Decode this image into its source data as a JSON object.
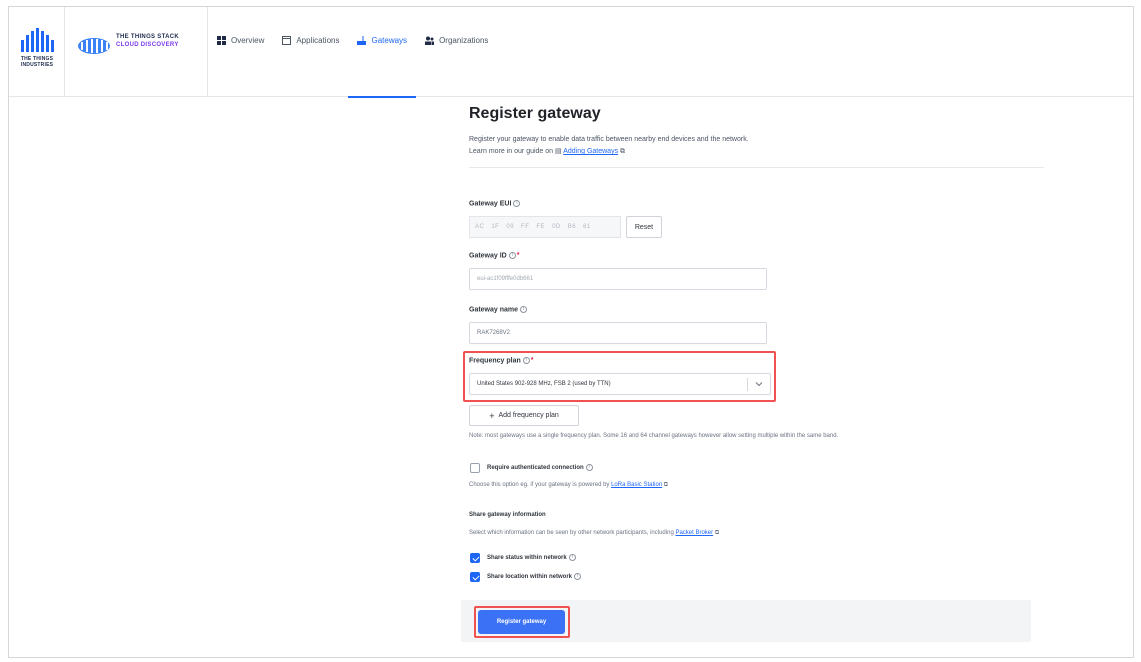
{
  "brand": {
    "ttn_name": "THE THINGS INDUSTRIES",
    "product_line1": "THE THINGS STACK",
    "product_line2": "CLOUD DISCOVERY"
  },
  "nav": {
    "items": [
      {
        "label": "Overview",
        "icon": "grid-icon",
        "active": false
      },
      {
        "label": "Applications",
        "icon": "window-icon",
        "active": false
      },
      {
        "label": "Gateways",
        "icon": "gateway-icon",
        "active": true
      },
      {
        "label": "Organizations",
        "icon": "users-icon",
        "active": false
      }
    ]
  },
  "form": {
    "title": "Register gateway",
    "description": "Register your gateway to enable data traffic between nearby end devices and the network.",
    "guide_prefix": "Learn more in our guide on",
    "guide_link": "Adding Gateways",
    "eui": {
      "label": "Gateway EUI",
      "bytes": [
        "AC",
        "1F",
        "09",
        "FF",
        "FE",
        "0D",
        "B6",
        "61"
      ],
      "reset_label": "Reset"
    },
    "gateway_id": {
      "label": "Gateway ID",
      "placeholder": "eui-ac1f09fffe0db661"
    },
    "gateway_name": {
      "label": "Gateway name",
      "value": "RAK7268V2"
    },
    "frequency_plan": {
      "label": "Frequency plan",
      "selected": "United States 902-928 MHz, FSB 2 (used by TTN)",
      "add_label": "Add frequency plan",
      "note": "Note: most gateways use a single frequency plan. Some 16 and 64 channel gateways however allow setting multiple within the same band."
    },
    "auth": {
      "label": "Require authenticated connection",
      "checked": false,
      "help_prefix": "Choose this option eg. if your gateway is powered by",
      "help_link": "LoRa Basic Station"
    },
    "share": {
      "heading": "Share gateway information",
      "help_prefix": "Select which information can be seen by other network participants, including",
      "help_link": "Packet Broker",
      "status_label": "Share status within network",
      "status_checked": true,
      "location_label": "Share location within network",
      "location_checked": true
    },
    "submit_label": "Register gateway"
  },
  "colors": {
    "accent": "#1e66f5",
    "highlight": "#f05252",
    "brand_purple": "#7c3aed"
  }
}
